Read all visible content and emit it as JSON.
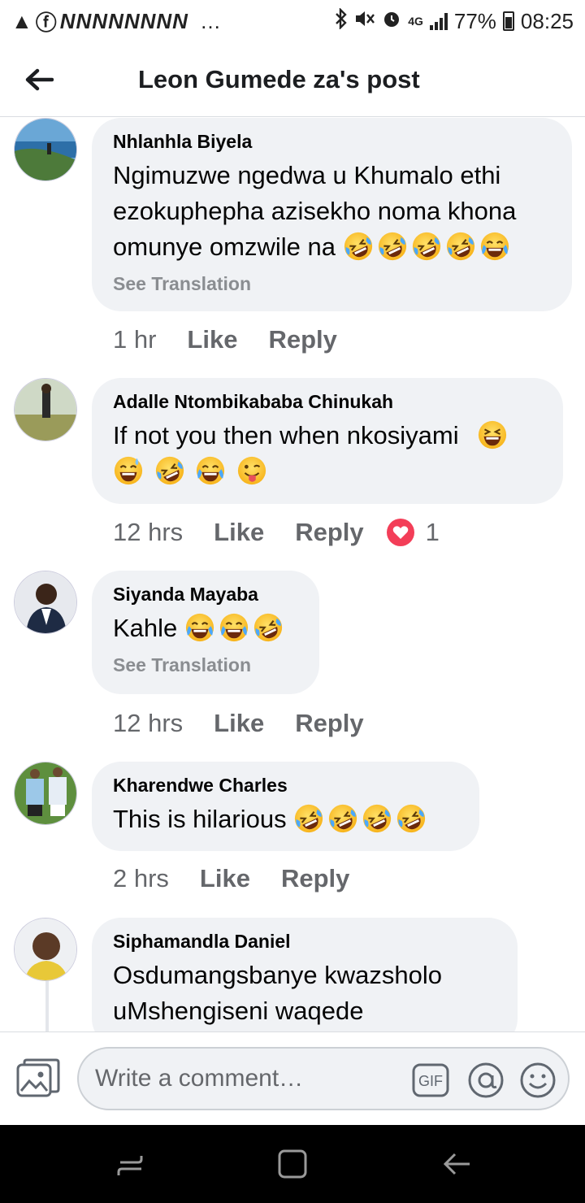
{
  "status_bar": {
    "left_glyphs": [
      "▲",
      "ⓕ"
    ],
    "notification_letters": "NNNNNNNN",
    "overflow": "…",
    "network": "4G",
    "battery": "77%",
    "time": "08:25"
  },
  "header": {
    "title": "Leon Gumede za's post"
  },
  "comments": [
    {
      "author": "Nhlanhla Biyela",
      "text": "Ngimuzwe ngedwa u Khumalo ethi ezokuphepha azisekho noma khona omunye omzwile na",
      "emojis": [
        "rofl",
        "rofl",
        "rofl",
        "rofl",
        "joy"
      ],
      "see_translation": "See Translation",
      "time": "1 hr",
      "like": "Like",
      "reply": "Reply"
    },
    {
      "author": "Adalle Ntombikababa Chinukah",
      "text": "If not you then when nkosiyami",
      "emojis": [
        "laughing",
        "sweat-smile",
        "rofl",
        "joy",
        "wink-tongue"
      ],
      "time": "12 hrs",
      "like": "Like",
      "reply": "Reply",
      "reaction_count": "1"
    },
    {
      "author": "Siyanda Mayaba",
      "text": "Kahle",
      "emojis": [
        "joy",
        "joy",
        "rofl"
      ],
      "see_translation": "See Translation",
      "time": "12 hrs",
      "like": "Like",
      "reply": "Reply"
    },
    {
      "author": "Kharendwe Charles",
      "text": "This is hilarious",
      "emojis": [
        "rofl",
        "rofl",
        "rofl",
        "rofl"
      ],
      "time": "2 hrs",
      "like": "Like",
      "reply": "Reply"
    },
    {
      "author": "Siphamandla Daniel",
      "text": "Osdumangsbanye kwazsholo uMshengiseni waqede"
    }
  ],
  "composer": {
    "placeholder": "Write a comment…",
    "gif_label": "GIF"
  },
  "colors": {
    "bubble": "#f0f2f5",
    "meta": "#65676b",
    "heart": "#f33e58",
    "emoji_face": "#ffcc33"
  }
}
